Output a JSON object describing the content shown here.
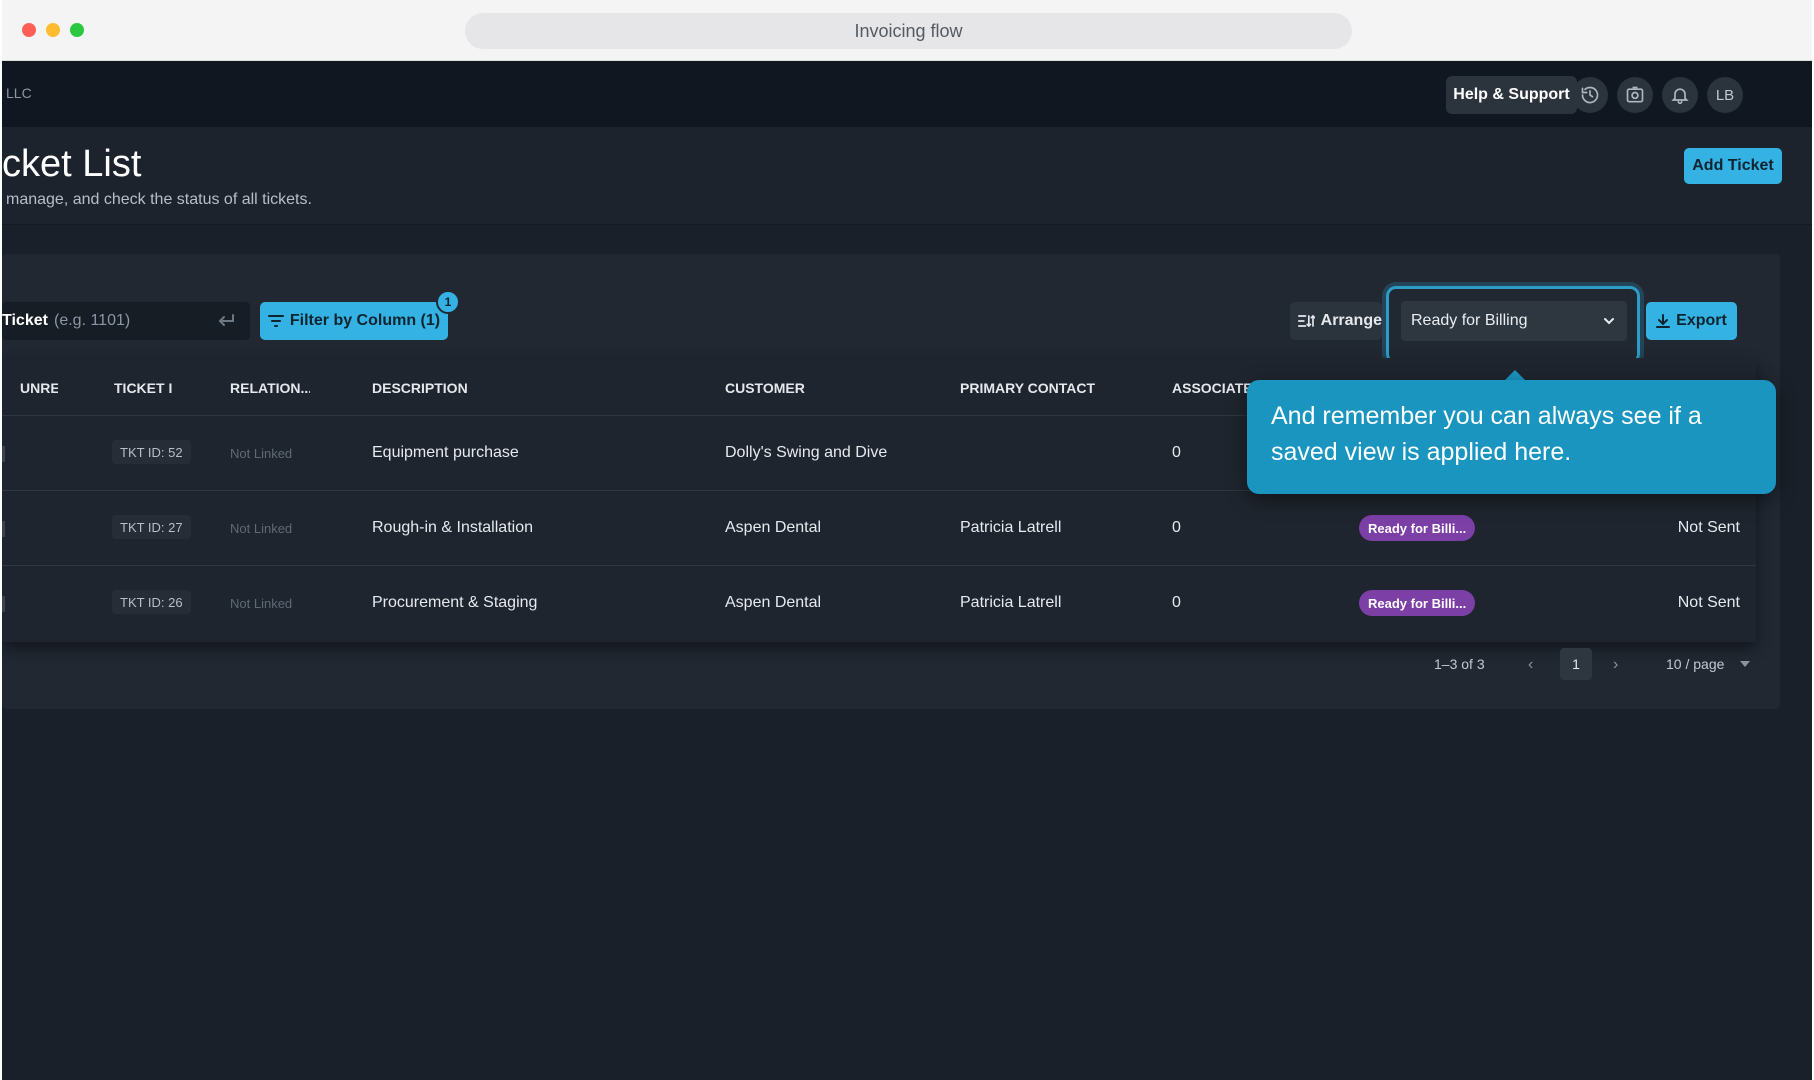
{
  "browser": {
    "title": "Invoicing flow"
  },
  "header": {
    "org_name": "LLC",
    "help_label": "Help & Support",
    "avatar_initials": "LB",
    "icons": [
      "history-icon",
      "camera-icon",
      "bell-icon"
    ]
  },
  "page": {
    "title": "cket List",
    "subtitle": "manage, and check the status of all tickets.",
    "add_label": "Add Ticket"
  },
  "toolbar": {
    "search_label": "Ticket",
    "search_placeholder": "(e.g. 1101)",
    "filter_label": "Filter by Column (1)",
    "filter_count": "1",
    "arrange_label": "Arrange",
    "view_selected": "Ready for Billing",
    "export_label": "Export"
  },
  "table": {
    "columns": [
      "UNRE",
      "TICKET I",
      "RELATION...",
      "DESCRIPTION",
      "CUSTOMER",
      "PRIMARY CONTACT",
      "ASSOCIATED"
    ],
    "rows": [
      {
        "ticket": "TKT ID: 52",
        "relation": "Not Linked",
        "description": "Equipment purchase",
        "customer": "Dolly's Swing and Dive",
        "contact": "",
        "associated": "0",
        "status": "",
        "invoice": ""
      },
      {
        "ticket": "TKT ID: 27",
        "relation": "Not Linked",
        "description": "Rough-in & Installation",
        "customer": "Aspen Dental",
        "contact": "Patricia Latrell",
        "associated": "0",
        "status": "Ready for Billi...",
        "invoice": "Not Sent"
      },
      {
        "ticket": "TKT ID: 26",
        "relation": "Not Linked",
        "description": "Procurement & Staging",
        "customer": "Aspen Dental",
        "contact": "Patricia Latrell",
        "associated": "0",
        "status": "Ready for Billi...",
        "invoice": "Not Sent"
      }
    ]
  },
  "pagination": {
    "range": "1–3 of 3",
    "current_page": "1",
    "page_size": "10 / page"
  },
  "tooltip": {
    "text": "And remember you can always see if a saved view is applied here."
  },
  "colors": {
    "accent": "#33b2e3",
    "tooltip": "#1a95c0",
    "status_pill": "#7b3fa6",
    "background": "#1a2029"
  }
}
